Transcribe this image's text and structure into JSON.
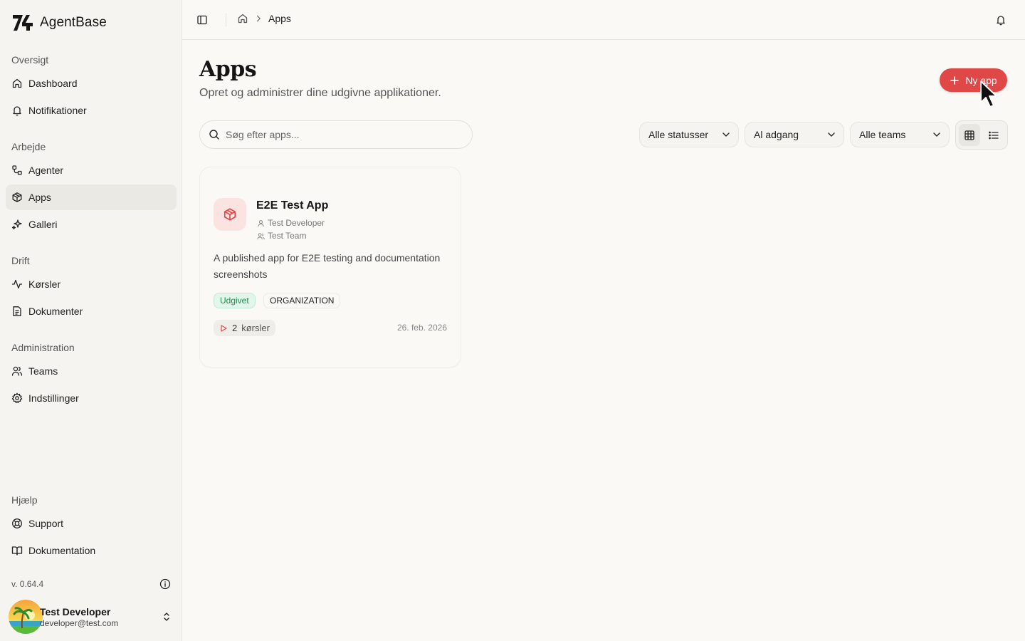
{
  "app": {
    "name": "AgentBase"
  },
  "sidebar": {
    "sections": [
      {
        "heading": "Oversigt",
        "items": [
          {
            "label": "Dashboard"
          },
          {
            "label": "Notifikationer"
          }
        ]
      },
      {
        "heading": "Arbejde",
        "items": [
          {
            "label": "Agenter"
          },
          {
            "label": "Apps",
            "active": true
          },
          {
            "label": "Galleri"
          }
        ]
      },
      {
        "heading": "Drift",
        "items": [
          {
            "label": "Kørsler"
          },
          {
            "label": "Dokumenter"
          }
        ]
      },
      {
        "heading": "Administration",
        "items": [
          {
            "label": "Teams"
          },
          {
            "label": "Indstillinger"
          }
        ]
      },
      {
        "heading": "Hjælp",
        "items": [
          {
            "label": "Support"
          },
          {
            "label": "Dokumentation"
          }
        ]
      }
    ],
    "version": "v. 0.64.4",
    "user": {
      "name": "Test Developer",
      "email": "developer@test.com"
    }
  },
  "topbar": {
    "breadcrumb": [
      "Apps"
    ]
  },
  "page": {
    "title": "Apps",
    "subtitle": "Opret og administrer dine udgivne applikationer.",
    "new_button_label": "Ny app",
    "search_placeholder": "Søg efter apps...",
    "filters": {
      "status": "Alle statusser",
      "access": "Al adgang",
      "teams": "Alle teams"
    },
    "view_mode": "grid"
  },
  "apps": [
    {
      "name": "E2E Test App",
      "developer": "Test Developer",
      "team": "Test Team",
      "description": "A published app for E2E testing and documentation screenshots",
      "status": "Udgivet",
      "access": "ORGANIZATION",
      "runs_count": "2",
      "runs_label": "kørsler",
      "date": "26. feb. 2026"
    }
  ],
  "colors": {
    "accent": "#e04848",
    "status_published": "#1f8a4c",
    "active_nav_bg": "#ebe9e4"
  }
}
